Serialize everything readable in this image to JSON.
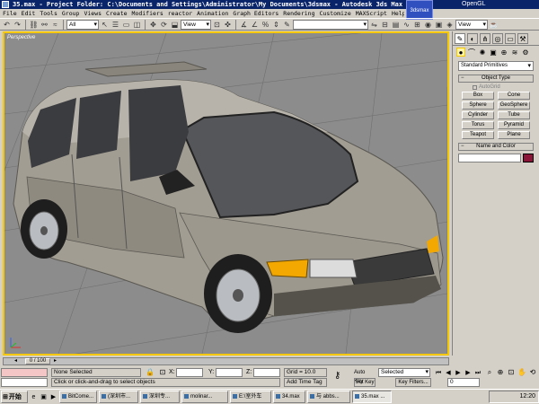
{
  "window": {
    "title": "35.max - Project Folder: C:\\Documents and Settings\\Administrator\\My Documents\\3dsmax - Autodesk 3ds Max 9",
    "renderer": "OpenGL",
    "badge": "3dsmax"
  },
  "menu": [
    "File",
    "Edit",
    "Tools",
    "Group",
    "Views",
    "Create",
    "Modifiers",
    "reactor",
    "Animation",
    "Graph Editors",
    "Rendering",
    "Customize",
    "MAXScript",
    "Help"
  ],
  "toolbar": {
    "filter_value": "All",
    "refcoord_value": "View",
    "named_sel_value": "",
    "view_right": "View"
  },
  "viewport": {
    "label": "Perspective"
  },
  "command_panel": {
    "dropdown": "Standard Primitives",
    "rollout_object_type": "Object Type",
    "autogrid": "AutoGrid",
    "primitives": [
      "Box",
      "Cone",
      "Sphere",
      "GeoSphere",
      "Cylinder",
      "Tube",
      "Torus",
      "Pyramid",
      "Teapot",
      "Plane"
    ],
    "rollout_name_color": "Name and Color",
    "object_color": "#8b1538"
  },
  "timeline": {
    "frame_label": "0 / 100"
  },
  "status": {
    "selection": "None Selected",
    "prompt": "Click or click-and-drag to select objects",
    "x_label": "X:",
    "y_label": "Y:",
    "z_label": "Z:",
    "grid": "Grid = 10.0",
    "add_time_tag": "Add Time Tag",
    "auto_key": "Auto Key",
    "set_key": "Set Key",
    "selected_value": "Selected",
    "key_filters": "Key Filters...",
    "current_frame": "0"
  },
  "taskbar": {
    "start": "开始",
    "items": [
      "BitCome...",
      "(深圳市...",
      "深圳专...",
      "molinar...",
      "E:\\室外车",
      "34.max",
      "与 abbs...",
      "35.max ..."
    ],
    "clock": "12:20"
  }
}
